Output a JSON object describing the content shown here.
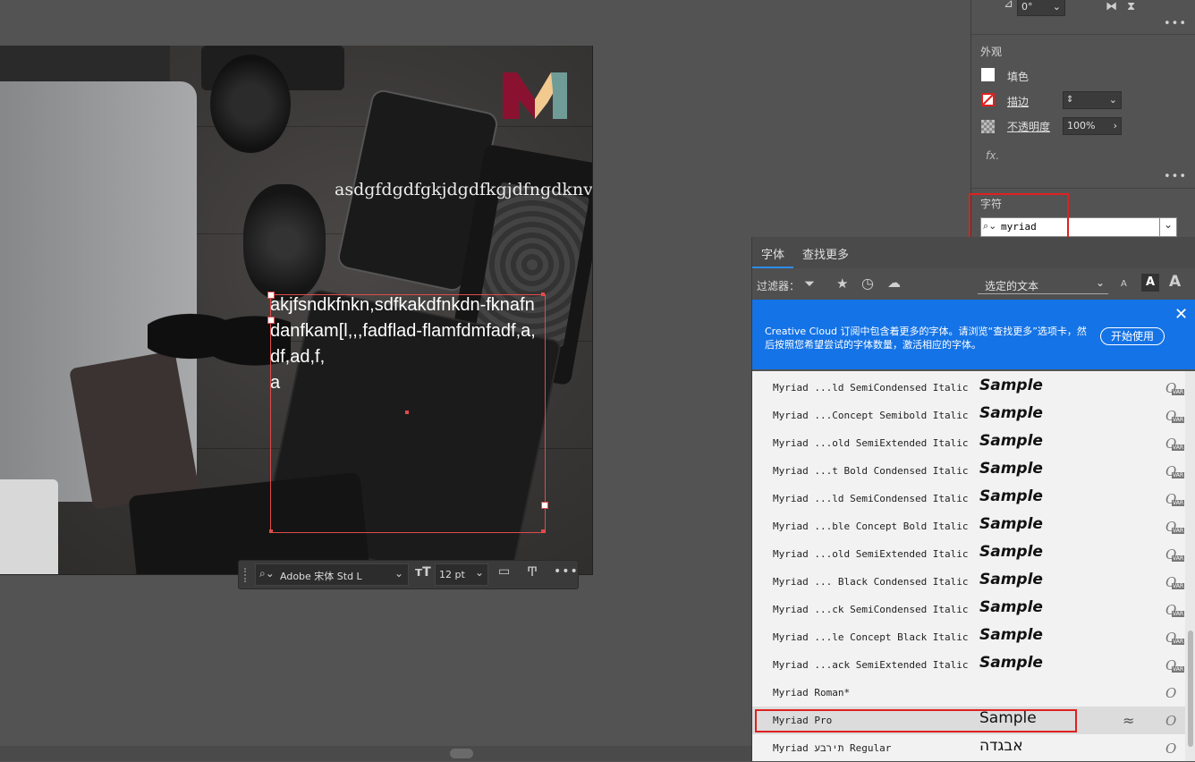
{
  "canvas": {
    "text_line1": "asdgfdgdfgkjdgdfkgjdfngdknvndkfnvdnvnd",
    "text_frame_content": "akjfsndkfnkn,sdfkakdfnkdn-fknafndanfkam[l,,,fadflad-flamfdmfadf,a,df,ad,f,\na"
  },
  "context_toolbar": {
    "font_name": "Adobe 宋体 Std L",
    "font_size": "12 pt"
  },
  "properties": {
    "rotate_value": "0°",
    "appearance_title": "外观",
    "fill_label": "填色",
    "stroke_label": "描边",
    "opacity_label": "不透明度",
    "opacity_value": "100%",
    "fx_label": "fx.",
    "character_title": "字符",
    "font_search_value": "myriad"
  },
  "font_panel": {
    "tabs": [
      "字体",
      "查找更多"
    ],
    "filter_label": "过滤器：",
    "preview_select": "选定的文本",
    "banner_text": "Creative Cloud 订阅中包含着更多的字体。请浏览“查找更多”选项卡，然后按照您希望尝试的字体数量，激活相应的字体。",
    "banner_button": "开始使用",
    "fonts": [
      {
        "name": "Myriad ...ld SemiCondensed Italic",
        "sample": "Sample",
        "style": "italic"
      },
      {
        "name": "Myriad ...Concept Semibold Italic",
        "sample": "Sample",
        "style": "italic"
      },
      {
        "name": "Myriad ...old SemiExtended Italic",
        "sample": "Sample",
        "style": "italic"
      },
      {
        "name": "Myriad ...t Bold Condensed Italic",
        "sample": "Sample",
        "style": "italic"
      },
      {
        "name": "Myriad ...ld SemiCondensed Italic",
        "sample": "Sample",
        "style": "italic"
      },
      {
        "name": "Myriad ...ble Concept Bold Italic",
        "sample": "Sample",
        "style": "italic"
      },
      {
        "name": "Myriad ...old SemiExtended Italic",
        "sample": "Sample",
        "style": "italic"
      },
      {
        "name": "Myriad ... Black Condensed Italic",
        "sample": "Sample",
        "style": "italic"
      },
      {
        "name": "Myriad ...ck SemiCondensed Italic",
        "sample": "Sample",
        "style": "italic"
      },
      {
        "name": "Myriad ...le Concept Black Italic",
        "sample": "Sample",
        "style": "italic"
      },
      {
        "name": "Myriad ...ack SemiExtended Italic",
        "sample": "Sample",
        "style": "italic"
      },
      {
        "name": "Myriad Roman*",
        "sample": "",
        "style": "regular"
      },
      {
        "name": "Myriad Pro",
        "sample": "Sample",
        "style": "regular"
      },
      {
        "name": "Myriad תירבע Regular",
        "sample": "אבגדה",
        "style": "regular"
      }
    ],
    "similar_icon": "≈",
    "opentype_icon": "O",
    "var_badge": "VAR"
  },
  "colors": {
    "accent_blue": "#1473e6",
    "highlight_red": "#e02020"
  }
}
